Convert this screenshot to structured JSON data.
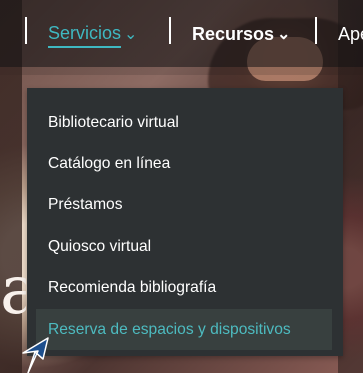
{
  "page": {
    "decorative_background_letter": "a"
  },
  "nav": {
    "items": [
      {
        "label": "Servicios",
        "icon": "chevron-down-icon",
        "state": "active"
      },
      {
        "label": "Recursos",
        "icon": "chevron-down-icon",
        "state": "default"
      },
      {
        "label": "Ape",
        "state": "partially-visible"
      }
    ],
    "chevron_glyph": "⌄"
  },
  "dropdown": {
    "items": [
      {
        "label": "Bibliotecario virtual"
      },
      {
        "label": "Catálogo en línea"
      },
      {
        "label": "Préstamos"
      },
      {
        "label": "Quiosco virtual"
      },
      {
        "label": "Recomienda bibliografía"
      },
      {
        "label": "Reserva de espacios y dispositivos",
        "state": "highlighted"
      }
    ]
  },
  "colors": {
    "accent": "#3FB8C1",
    "dropdown_background": "#2D3133",
    "highlight_background": "#38403F",
    "cursor": "#1D4F8D"
  },
  "icons": {
    "cursor": "mouse-pointer-icon"
  }
}
